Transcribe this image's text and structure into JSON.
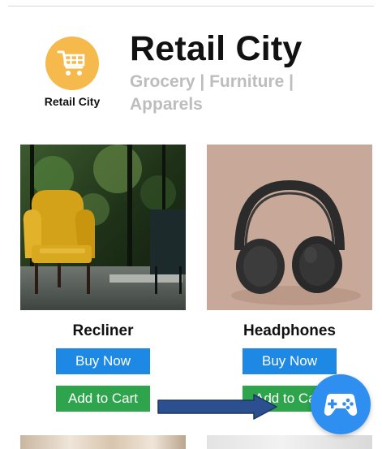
{
  "header": {
    "logo_caption": "Retail City",
    "store_name": "Retail City",
    "tagline": "Grocery | Furniture | Apparels"
  },
  "products": [
    {
      "name": "Recliner",
      "buy_label": "Buy Now",
      "cart_label": "Add to Cart"
    },
    {
      "name": "Headphones",
      "buy_label": "Buy Now",
      "cart_label": "Add to Cart"
    }
  ],
  "colors": {
    "brand_orange": "#f6b94c",
    "buy_blue": "#1e88e5",
    "cart_green": "#2ea54c",
    "fab_blue": "#2f8ff0",
    "annotation_arrow": "#2b4f8f"
  },
  "icons": {
    "logo": "shopping-cart-icon",
    "fab": "gamepad-icon",
    "annotation": "arrow-right-icon"
  }
}
